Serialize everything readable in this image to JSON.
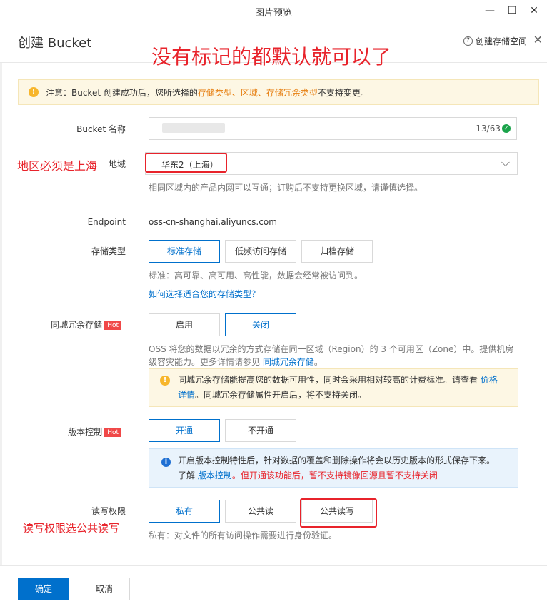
{
  "window": {
    "title": "图片预览",
    "minimize": "—",
    "maximize": "☐",
    "close": "✕"
  },
  "header": {
    "title": "创建 Bucket",
    "help_icon": "?",
    "help_label": "创建存储空间",
    "close": "✕"
  },
  "annotations": {
    "top": "没有标记的都默认就可以了",
    "region": "地区必须是上海",
    "acl": "读写权限选公共读写"
  },
  "notice": {
    "icon": "!",
    "prefix": "注意：Bucket 创建成功后，您所选择的 ",
    "highlight": "存储类型、区域、存储冗余类型",
    "suffix": " 不支持变更。"
  },
  "bucket_name": {
    "label": "Bucket 名称",
    "counter": "13/63",
    "check_icon": "✓"
  },
  "region": {
    "label": "地域",
    "value": "华东2（上海）",
    "arrow": "⌵",
    "hint": "相同区域内的产品内网可以互通；订购后不支持更换区域，请谨慎选择。"
  },
  "endpoint": {
    "label": "Endpoint",
    "value": "oss-cn-shanghai.aliyuncs.com"
  },
  "storage_class": {
    "label": "存储类型",
    "options": [
      "标准存储",
      "低频访问存储",
      "归档存储"
    ],
    "hint": "标准：高可靠、高可用、高性能，数据会经常被访问到。",
    "link": "如何选择适合您的存储类型？"
  },
  "redundancy": {
    "label": "同城冗余存储",
    "hot": "Hot",
    "options": [
      "启用",
      "关闭"
    ],
    "desc_line1": "OSS 将您的数据以冗余的方式存储在同一区域（Region）的 3 个可用区（Zone）中。提供机房",
    "desc_line2_prefix": "级容灾能力。更多详情请参见 ",
    "desc_link": "同城冗余存储",
    "desc_line2_suffix": "。",
    "warn_icon": "!",
    "warn_line1_prefix": "同城冗余存储能提高您的数据可用性，同时会采用相对较高的计费标准。请查看 ",
    "warn_link1": "价格",
    "warn_link2": "详情",
    "warn_line2_suffix": "。同城冗余存储属性开启后，将不支持关闭。"
  },
  "versioning": {
    "label": "版本控制",
    "hot": "Hot",
    "options": [
      "开通",
      "不开通"
    ],
    "info_icon": "i",
    "info_line1": "开启版本控制特性后，针对数据的覆盖和删除操作将会以历史版本的形式保存下来。",
    "info_line2_prefix": "了解 ",
    "info_link": "版本控制",
    "info_line2_red": "。但开通该功能后，暂不支持镜像回源且暂不支持关闭"
  },
  "acl": {
    "label": "读写权限",
    "options": [
      "私有",
      "公共读",
      "公共读写"
    ],
    "hint": "私有：对文件的所有访问操作需要进行身份验证。"
  },
  "footer": {
    "confirm": "确定",
    "cancel": "取消"
  },
  "colors": {
    "primary": "#0070cc",
    "annotation_red": "#e8232b",
    "notice_bg": "#fdf7e4",
    "info_bg": "#e9f3fc",
    "highlight_orange": "#e67e0f"
  }
}
